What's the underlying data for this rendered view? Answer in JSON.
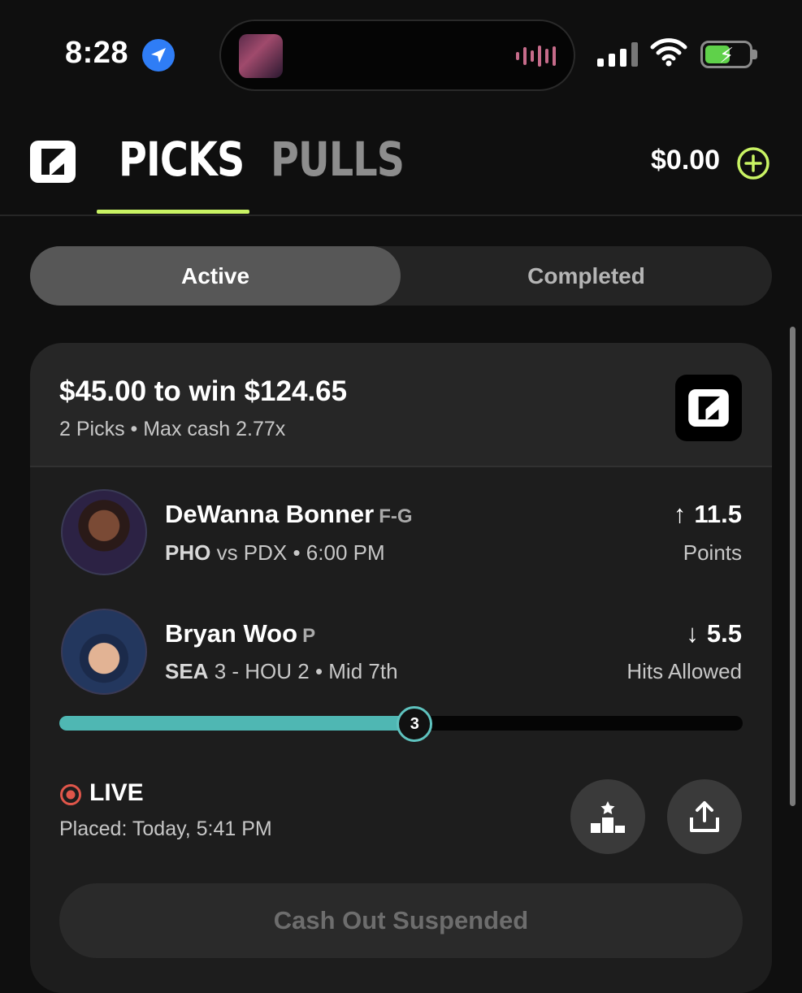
{
  "status_bar": {
    "time": "8:28"
  },
  "header": {
    "tabs": [
      {
        "label": "PICKS",
        "active": true
      },
      {
        "label": "PULLS",
        "active": false
      }
    ],
    "balance": "$0.00",
    "accent_color": "#c9f364"
  },
  "filter": {
    "options": [
      "Active",
      "Completed"
    ],
    "selected": "Active"
  },
  "entry": {
    "title": "$45.00 to win $124.65",
    "subtitle": "2 Picks • Max cash 2.77x",
    "picks": [
      {
        "name": "DeWanna Bonner",
        "position": "F-G",
        "team": "PHO",
        "matchup": " vs PDX • 6:00 PM",
        "direction_icon": "arrow-up-icon",
        "arrow": "↑",
        "line": "11.5",
        "stat": "Points"
      },
      {
        "name": "Bryan Woo",
        "position": "P",
        "team": "SEA",
        "matchup": " 3 - HOU 2 • Mid 7th",
        "direction_icon": "arrow-down-icon",
        "arrow": "↓",
        "line": "5.5",
        "stat": "Hits Allowed"
      }
    ],
    "progress": {
      "current": "3",
      "target": 5.5,
      "fraction": 0.52,
      "color": "#4fb7b3"
    },
    "status": "LIVE",
    "live_color": "#e0564a",
    "placed": "Placed: Today, 5:41 PM",
    "cashout_label": "Cash Out Suspended"
  }
}
